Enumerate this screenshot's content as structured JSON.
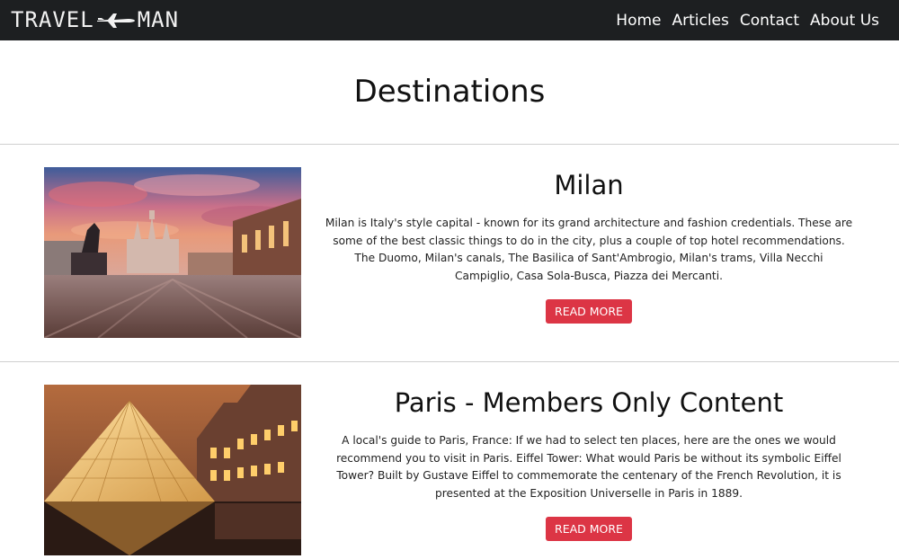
{
  "brand": {
    "left": "TRAVEL",
    "right": "MAN",
    "icon": "airplane-icon"
  },
  "nav": [
    {
      "label": "Home"
    },
    {
      "label": "Articles"
    },
    {
      "label": "Contact"
    },
    {
      "label": "About Us"
    }
  ],
  "page": {
    "title": "Destinations"
  },
  "cards": [
    {
      "title": "Milan",
      "text": "Milan is Italy's style capital - known for its grand architecture and fashion credentials. These are some of the best classic things to do in the city, plus a couple of top hotel recommendations. The Duomo, Milan's canals, The Basilica of Sant'Ambrogio, Milan's trams, Villa Necchi Campiglio, Casa Sola-Busca, Piazza dei Mercanti.",
      "button": "READ MORE"
    },
    {
      "title": "Paris - Members Only Content",
      "text": "A local's guide to Paris, France: If we had to select ten places, here are the ones we would recommend you to visit in Paris. Eiffel Tower: What would Paris be without its symbolic Eiffel Tower? Built by Gustave Eiffel to commemorate the centenary of the French Revolution, it is presented at the Exposition Universelle in Paris in 1889.",
      "button": "READ MORE"
    }
  ],
  "colors": {
    "navbar": "#1d1f21",
    "button": "#dc3545"
  }
}
